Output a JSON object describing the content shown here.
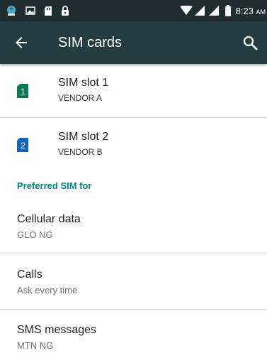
{
  "status_bar": {
    "time": "8:23",
    "ampm": "AM",
    "icons": [
      "notification-globe-icon",
      "image-icon",
      "sd-card-icon",
      "lock-icon",
      "wifi-icon",
      "signal-icon",
      "signal-icon",
      "battery-icon"
    ]
  },
  "toolbar": {
    "title": "SIM cards",
    "back_icon": "arrow-left-icon",
    "search_icon": "search-icon"
  },
  "sims": [
    {
      "slot_label": "SIM slot 1",
      "vendor": "VENDOR A",
      "badge": "1",
      "color": "#0a7a52"
    },
    {
      "slot_label": "SIM slot 2",
      "vendor": "VENDOR B",
      "badge": "2",
      "color": "#1565c0"
    }
  ],
  "preferred": {
    "header": "Preferred SIM for",
    "items": [
      {
        "title": "Cellular data",
        "value": "GLO NG"
      },
      {
        "title": "Calls",
        "value": "Ask every time"
      },
      {
        "title": "SMS messages",
        "value": "MTN NG"
      }
    ]
  },
  "colors": {
    "status_bar": "#1f2d31",
    "toolbar": "#263c43",
    "accent": "#00897b"
  }
}
